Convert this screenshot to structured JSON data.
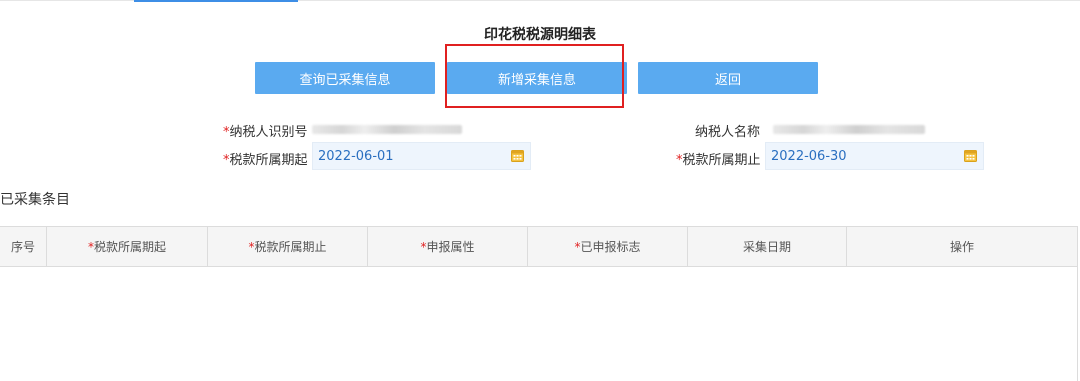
{
  "page": {
    "title": "印花税税源明细表"
  },
  "buttons": {
    "query_label": "查询已采集信息",
    "add_label": "新增采集信息",
    "back_label": "返回"
  },
  "form": {
    "taxpayer_id_label": "纳税人识别号",
    "taxpayer_name_label": "纳税人名称",
    "period_start_label": "税款所属期起",
    "period_start_value": "2022-06-01",
    "period_end_label": "税款所属期止",
    "period_end_value": "2022-06-30",
    "required_mark": "*"
  },
  "section": {
    "collected_items_title": "已采集条目"
  },
  "table": {
    "columns": [
      "序号",
      "税款所属期起",
      "税款所属期止",
      "申报属性",
      "已申报标志",
      "采集日期",
      "操作"
    ],
    "required_columns": [
      false,
      true,
      true,
      true,
      true,
      false,
      false
    ]
  },
  "colors": {
    "button_bg": "#5aaaf0",
    "highlight_border": "#e02020",
    "date_text": "#2a6fc0",
    "calendar_icon": "#e8b93a"
  },
  "icons": {
    "calendar": "calendar-icon"
  }
}
